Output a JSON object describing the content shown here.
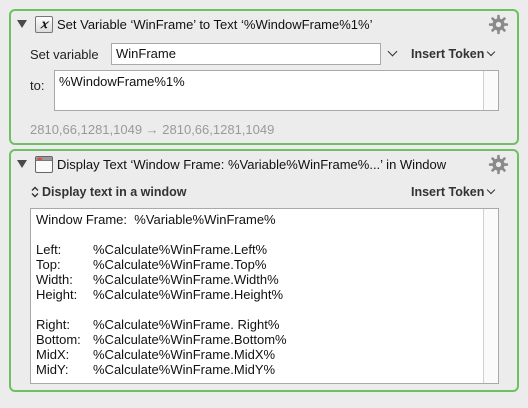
{
  "action1": {
    "title": "Set Variable ‘WinFrame’ to Text ‘%WindowFrame%1%’",
    "icon": "variable-x-icon",
    "set_variable_label": "Set variable",
    "variable_value": "WinFrame",
    "insert_token_label": "Insert Token",
    "to_label": "to:",
    "text_value": "%WindowFrame%1%",
    "preview": "2810,66,1281,1049 → 2810,66,1281,1049"
  },
  "action2": {
    "title": "Display Text ‘Window Frame:  %Variable%WinFrame%...’ in Window",
    "icon": "window-icon",
    "display_mode": "Display text in a window",
    "insert_token_label": "Insert Token",
    "text_lines": [
      {
        "label": "Window Frame:  ",
        "value": "%Variable%WinFrame%"
      },
      {
        "label": "",
        "value": ""
      },
      {
        "label": "Left:",
        "value": "%Calculate%WinFrame.Left%"
      },
      {
        "label": "Top:",
        "value": "%Calculate%WinFrame.Top%"
      },
      {
        "label": "Width:",
        "value": "%Calculate%WinFrame.Width%"
      },
      {
        "label": "Height:",
        "value": "%Calculate%WinFrame.Height%"
      },
      {
        "label": "",
        "value": ""
      },
      {
        "label": "Right:",
        "value": "%Calculate%WinFrame. Right%"
      },
      {
        "label": "Bottom:",
        "value": "%Calculate%WinFrame.Bottom%"
      },
      {
        "label": "MidX:",
        "value": "%Calculate%WinFrame.MidX%"
      },
      {
        "label": "MidY:",
        "value": "%Calculate%WinFrame.MidY%"
      }
    ]
  },
  "colors": {
    "action_border": "#6fbf63",
    "background": "#ececec",
    "preview_text": "#9a9a9a"
  }
}
